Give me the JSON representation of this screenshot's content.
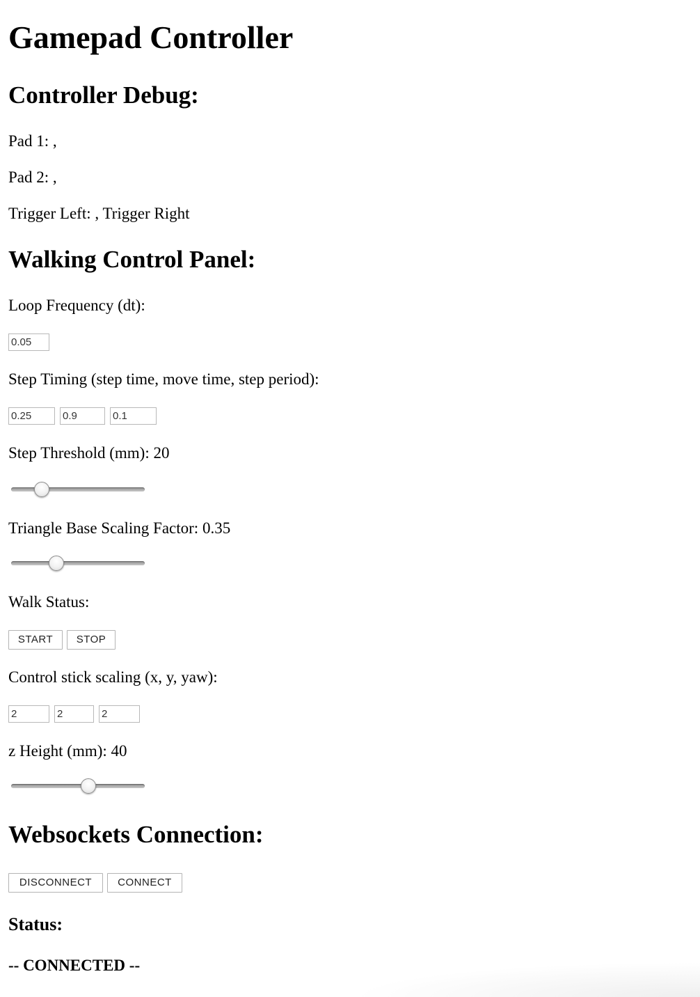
{
  "page": {
    "title": "Gamepad Controller"
  },
  "controller_debug": {
    "heading": "Controller Debug:",
    "pad1": "Pad 1: ,",
    "pad2": "Pad 2: ,",
    "triggers": "Trigger Left: , Trigger Right"
  },
  "walking_panel": {
    "heading": "Walking Control Panel:",
    "loop_frequency": {
      "label": "Loop Frequency (dt):",
      "value": "0.05",
      "visible_value": "0.05"
    },
    "step_timing": {
      "label": "Step Timing (step time, move time, step period):",
      "step_time": "0.25",
      "move_time": "0.9",
      "step_period": "0.1"
    },
    "step_threshold": {
      "label": "Step Threshold (mm): 20",
      "slider_fraction": 0.195
    },
    "triangle_scaling": {
      "label": "Triangle Base Scaling Factor: 0.35",
      "slider_fraction": 0.32
    },
    "walk_status": {
      "label": "Walk Status:",
      "start_label": "START",
      "stop_label": "STOP"
    },
    "stick_scaling": {
      "label": "Control stick scaling (x, y, yaw):",
      "x": "2",
      "y": "2",
      "yaw": "2"
    },
    "z_height": {
      "label": "z Height (mm): 40",
      "slider_fraction": 0.59
    }
  },
  "websockets": {
    "heading": "Websockets Connection:",
    "disconnect_label": "DISCONNECT",
    "connect_label": "CONNECT",
    "status_heading": "Status:",
    "status_value": "-- CONNECTED --"
  }
}
